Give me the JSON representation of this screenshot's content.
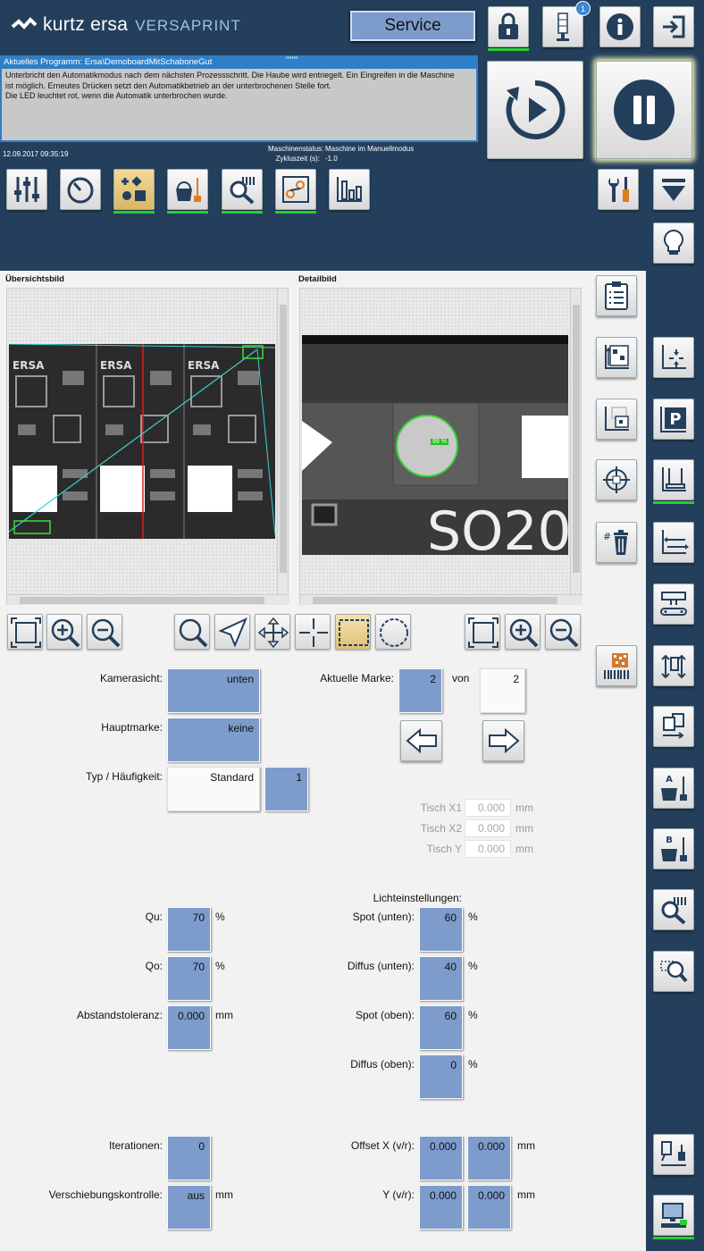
{
  "header": {
    "brand": "kurtz ersa",
    "product": "VERSAPRINT",
    "mode_button": "Service",
    "notification_count": "1",
    "program_label": "Aktuelles Programm: Ersa\\DemoboardMitSchaboneGut",
    "program_marker": "\"\"\"\"",
    "message_lines": [
      "Unterbricht den Automatikmodus nach dem nächsten Prozessschritt. Die Haube wird entriegelt. Ein Eingreifen in die Maschine",
      "ist möglich. Erneutes Drücken setzt den Automatikbetrieb an der unterbrochenen Stelle fort.",
      "Die LED leuchtet rot, wenn die Automatik unterbrochen wurde."
    ],
    "datetime": "12.09.2017 09:35:19",
    "machine_status_label": "Maschinenstatus:",
    "machine_status_value": "Maschine im Manuellmodus",
    "cycle_time_label": "Zykluszeit (s):",
    "cycle_time_value": "-1.0"
  },
  "panels": {
    "overview_title": "Übersichtsbild",
    "detail_title": "Detailbild",
    "match_percent": "99 %",
    "detail_text": "SO20"
  },
  "form": {
    "camera_view_label": "Kamerasicht:",
    "camera_view_value": "unten",
    "current_mark_label": "Aktuelle Marke:",
    "current_mark_value": "2",
    "of_label": "von",
    "mark_total": "2",
    "main_mark_label": "Hauptmarke:",
    "main_mark_value": "keine",
    "type_label": "Typ / Häufigkeit:",
    "type_value": "Standard",
    "frequency_value": "1",
    "table_x1_label": "Tisch X1",
    "table_x1_value": "0.000",
    "table_x2_label": "Tisch X2",
    "table_x2_value": "0.000",
    "table_y_label": "Tisch Y",
    "table_y_value": "0.000",
    "mm": "mm",
    "percent": "%",
    "light_settings_label": "Lichteinstellungen:",
    "qu_label": "Qu:",
    "qu_value": "70",
    "qo_label": "Qo:",
    "qo_value": "70",
    "distance_tol_label": "Abstandstoleranz:",
    "distance_tol_value": "0.000",
    "spot_bottom_label": "Spot (unten):",
    "spot_bottom_value": "60",
    "diffuse_bottom_label": "Diffus (unten):",
    "diffuse_bottom_value": "40",
    "spot_top_label": "Spot (oben):",
    "spot_top_value": "60",
    "diffuse_top_label": "Diffus (oben):",
    "diffuse_top_value": "0",
    "iterations_label": "Iterationen:",
    "iterations_value": "0",
    "shift_control_label": "Verschiebungskontrolle:",
    "shift_control_value": "aus",
    "offset_x_label": "Offset X (v/r):",
    "offset_x_front": "0.000",
    "offset_x_rear": "0.000",
    "offset_y_label": "Y (v/r):",
    "offset_y_front": "0.000",
    "offset_y_rear": "0.000"
  },
  "colors": {
    "header_bg": "#243f5c",
    "field_bg": "#7d9ccc",
    "active_indicator": "#27cf2e",
    "active_button": "#e8c97c",
    "message_border": "#2f7fc8"
  }
}
